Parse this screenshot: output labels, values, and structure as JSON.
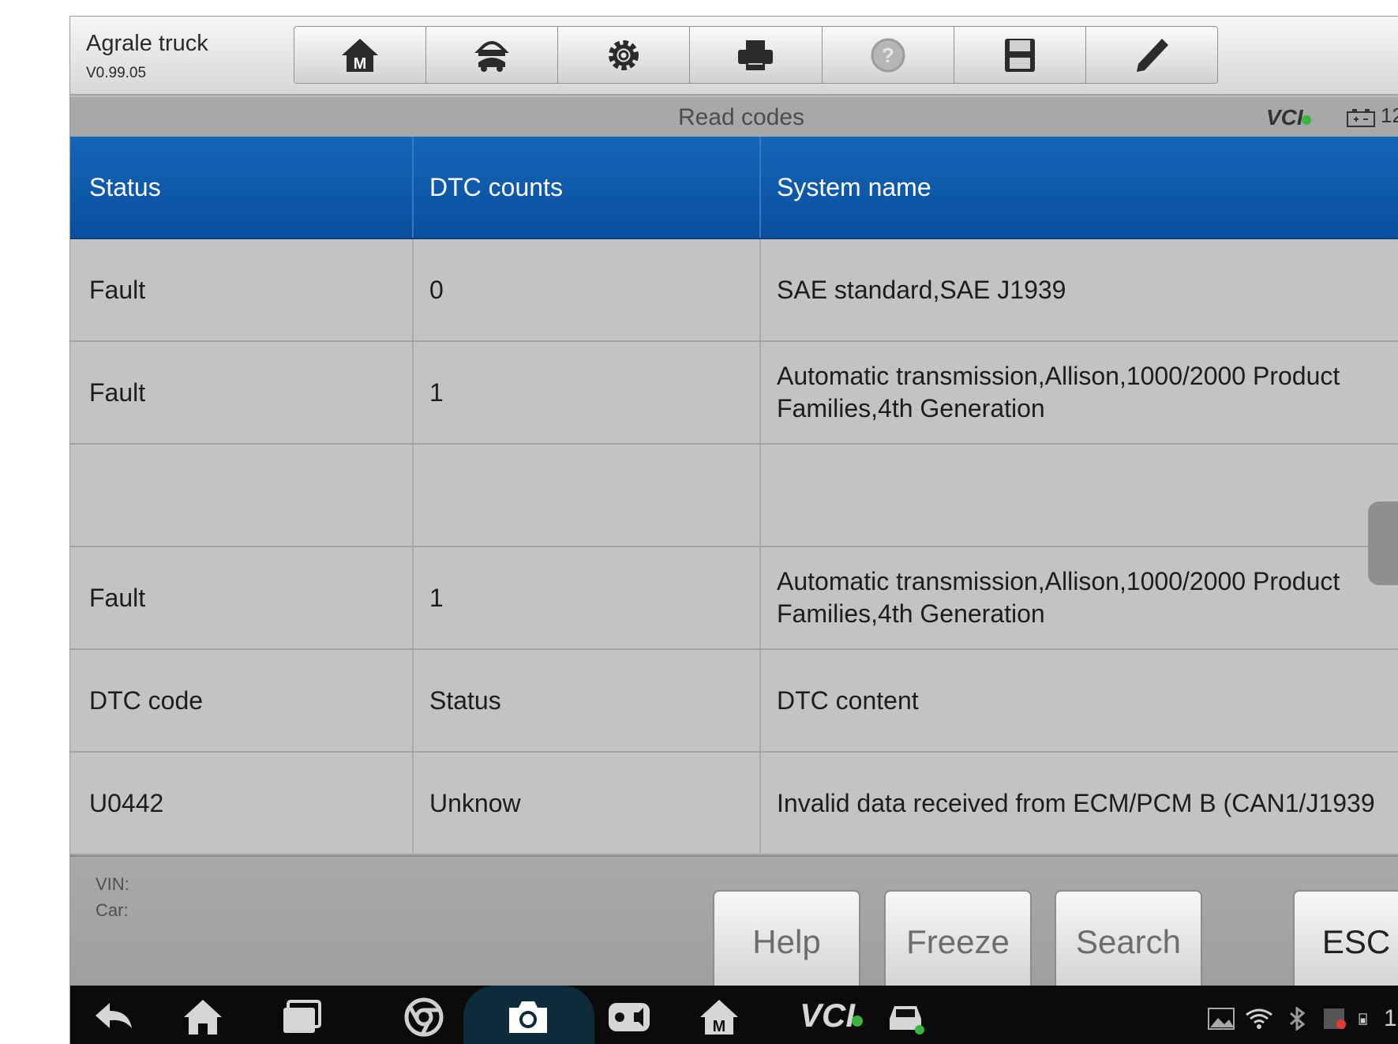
{
  "app": {
    "name": "Agrale truck",
    "version": "V0.99.05"
  },
  "toolbar": {
    "buttons": [
      {
        "icon": "home-icon"
      },
      {
        "icon": "vehicle-swap-icon"
      },
      {
        "icon": "gear-icon"
      },
      {
        "icon": "printer-icon"
      },
      {
        "icon": "help-icon"
      },
      {
        "icon": "save-icon"
      },
      {
        "icon": "pen-icon"
      }
    ]
  },
  "title_bar": {
    "title": "Read codes",
    "vci_label": "VCI",
    "battery_value": "12"
  },
  "table": {
    "headers": [
      "Status",
      "DTC counts",
      "System name"
    ],
    "rows": [
      [
        "Fault",
        "0",
        "SAE standard,SAE J1939"
      ],
      [
        "Fault",
        "1",
        "Automatic transmission,Allison,1000/2000 Product Families,4th Generation"
      ],
      [
        "",
        "",
        ""
      ],
      [
        "Fault",
        "1",
        "Automatic transmission,Allison,1000/2000 Product Families,4th Generation"
      ],
      [
        "DTC code",
        "Status",
        "DTC content"
      ],
      [
        "U0442",
        "Unknow",
        "Invalid data received from ECM/PCM B (CAN1/J1939"
      ]
    ]
  },
  "footer": {
    "vin_label": "VIN:",
    "car_label": "Car:",
    "buttons": {
      "help": "Help",
      "freeze": "Freeze",
      "search": "Search",
      "esc": "ESC"
    }
  },
  "nav_bar": {
    "vci_label": "VCI",
    "status_text": "1"
  },
  "colors": {
    "header_blue": "#0a4f9e",
    "toolbar_gray": "#d6d7d8",
    "row_gray": "#c1c3c5",
    "vci_green": "#3cb53c"
  }
}
